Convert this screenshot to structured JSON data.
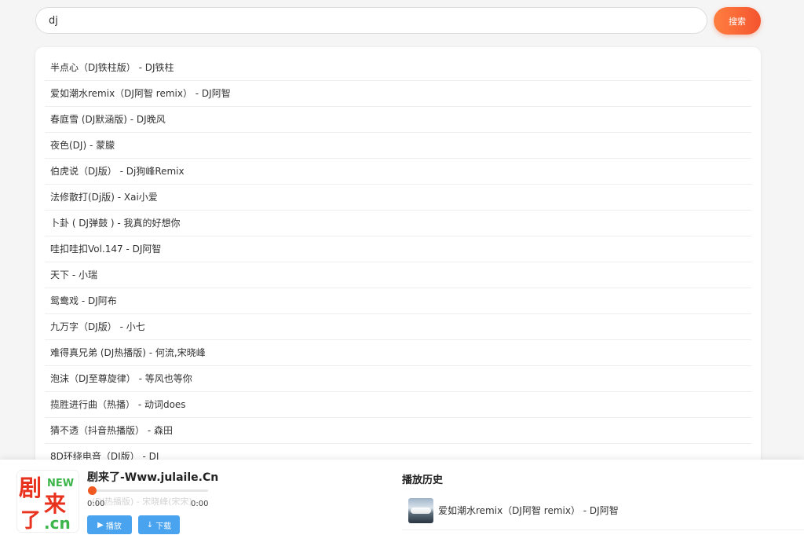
{
  "search": {
    "value": "dj",
    "button_label": "搜索"
  },
  "results": [
    "半点心（DJ铁柱版） - DJ铁柱",
    "爱如潮水remix（DJ阿智 remix） - DJ阿智",
    "春庭雪 (DJ默涵版) - DJ晚风",
    "夜色(DJ) - 蒙朦",
    "伯虎说（DJ版） - Dj狗峰Remix",
    "法修散打(Dj版) - Xai小爱",
    "卜卦 ( DJ弹鼓 ) - 我真的好想你",
    "哇扣哇扣Vol.147 - DJ阿智",
    "天下 - 小瑞",
    "鸳鸯戏 - DJ阿布",
    "九万字（DJ版） - 小七",
    "难得真兄弟 (DJ热播版) - 何流,宋晓峰",
    "泡沫（DJ至尊旋律） - 等风也等你",
    "揽胜进行曲（热播） - 动词does",
    "猜不透（抖音热播版） - 森田",
    "8D环绕电音（DJ版） - DJ"
  ],
  "player": {
    "logo_new": "NEW",
    "logo_text": "剧来了.cn",
    "site_title": "剧来了-Www.julaile.Cn",
    "ghost_text": "(DJ热播版) - 宋晓峰(宋宋)",
    "progress": 0.0,
    "time_current": "0:00",
    "time_total": "0:00",
    "play_label": "播放",
    "play_icon": "▶",
    "download_label": "下载",
    "download_icon": "↓"
  },
  "history": {
    "title": "播放历史",
    "items": [
      {
        "label": "爱如潮水remix（DJ阿智 remix） - DJ阿智",
        "thumb": "cloud-mountain-image"
      }
    ]
  },
  "colors": {
    "accent_orange": "#f05a22",
    "button_blue": "#4aa3ef",
    "logo_red": "#e8321e",
    "logo_green": "#3cb54a"
  }
}
